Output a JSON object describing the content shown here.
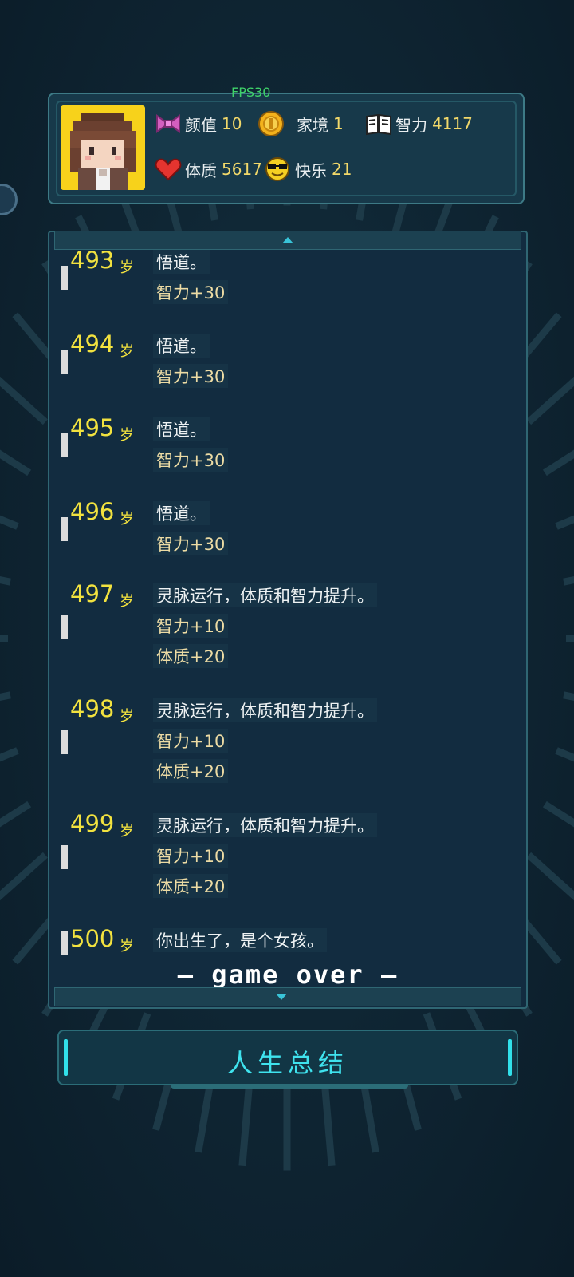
{
  "fps_label": "FPS30",
  "stats": {
    "appearance": {
      "label": "颜值",
      "value": "10"
    },
    "family": {
      "label": "家境",
      "value": "1"
    },
    "intelligence": {
      "label": "智力",
      "value": "4117"
    },
    "constitution": {
      "label": "体质",
      "value": "5617"
    },
    "happiness": {
      "label": "快乐",
      "value": "21"
    }
  },
  "age_unit": "岁",
  "log": [
    {
      "age": "493",
      "lines": [
        "悟道。"
      ],
      "deltas": [
        "智力+30"
      ]
    },
    {
      "age": "494",
      "lines": [
        "悟道。"
      ],
      "deltas": [
        "智力+30"
      ]
    },
    {
      "age": "495",
      "lines": [
        "悟道。"
      ],
      "deltas": [
        "智力+30"
      ]
    },
    {
      "age": "496",
      "lines": [
        "悟道。"
      ],
      "deltas": [
        "智力+30"
      ]
    },
    {
      "age": "497",
      "lines": [
        "灵脉运行，体质和智力提升。"
      ],
      "deltas": [
        "智力+10",
        "体质+20"
      ]
    },
    {
      "age": "498",
      "lines": [
        "灵脉运行，体质和智力提升。"
      ],
      "deltas": [
        "智力+10",
        "体质+20"
      ]
    },
    {
      "age": "499",
      "lines": [
        "灵脉运行，体质和智力提升。"
      ],
      "deltas": [
        "智力+10",
        "体质+20"
      ]
    },
    {
      "age": "500",
      "lines": [
        "你出生了，是个女孩。"
      ],
      "deltas": []
    }
  ],
  "game_over_label": "— game over —",
  "summary_button_label": "人生总结",
  "colors": {
    "accent": "#3fe3ee",
    "age_yellow": "#f2e23f",
    "delta_text": "#ecdba4",
    "fps_green": "#3fd36a"
  }
}
